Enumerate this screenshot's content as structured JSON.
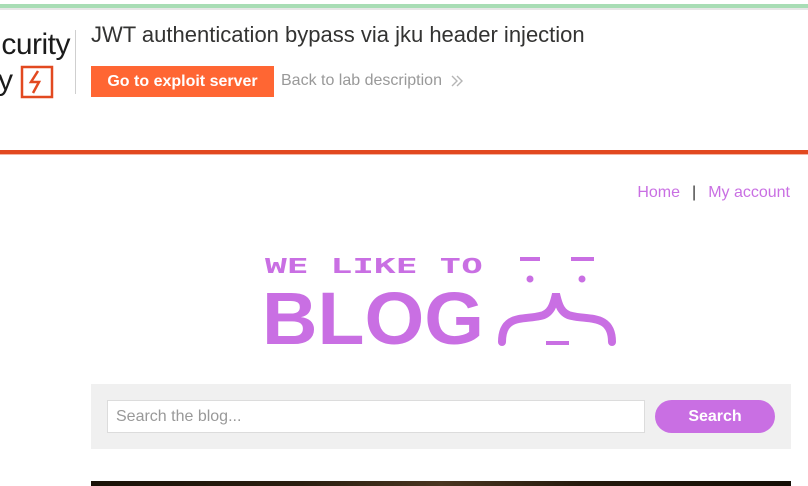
{
  "logo": {
    "line1": "curity",
    "line2": "y"
  },
  "lab": {
    "title": "JWT authentication bypass via jku header injection",
    "exploit_button": "Go to exploit server",
    "back_link": "Back to lab description"
  },
  "nav": {
    "home": "Home",
    "separator": "|",
    "my_account": "My account"
  },
  "hero": {
    "line1": "WE LIKE TO",
    "line2": "BLOG"
  },
  "search": {
    "placeholder": "Search the blog...",
    "button": "Search"
  },
  "colors": {
    "accent": "#c96fe3",
    "exploit": "#ff6633",
    "rule": "#e24920",
    "top_bar": "#a8ddb5"
  }
}
